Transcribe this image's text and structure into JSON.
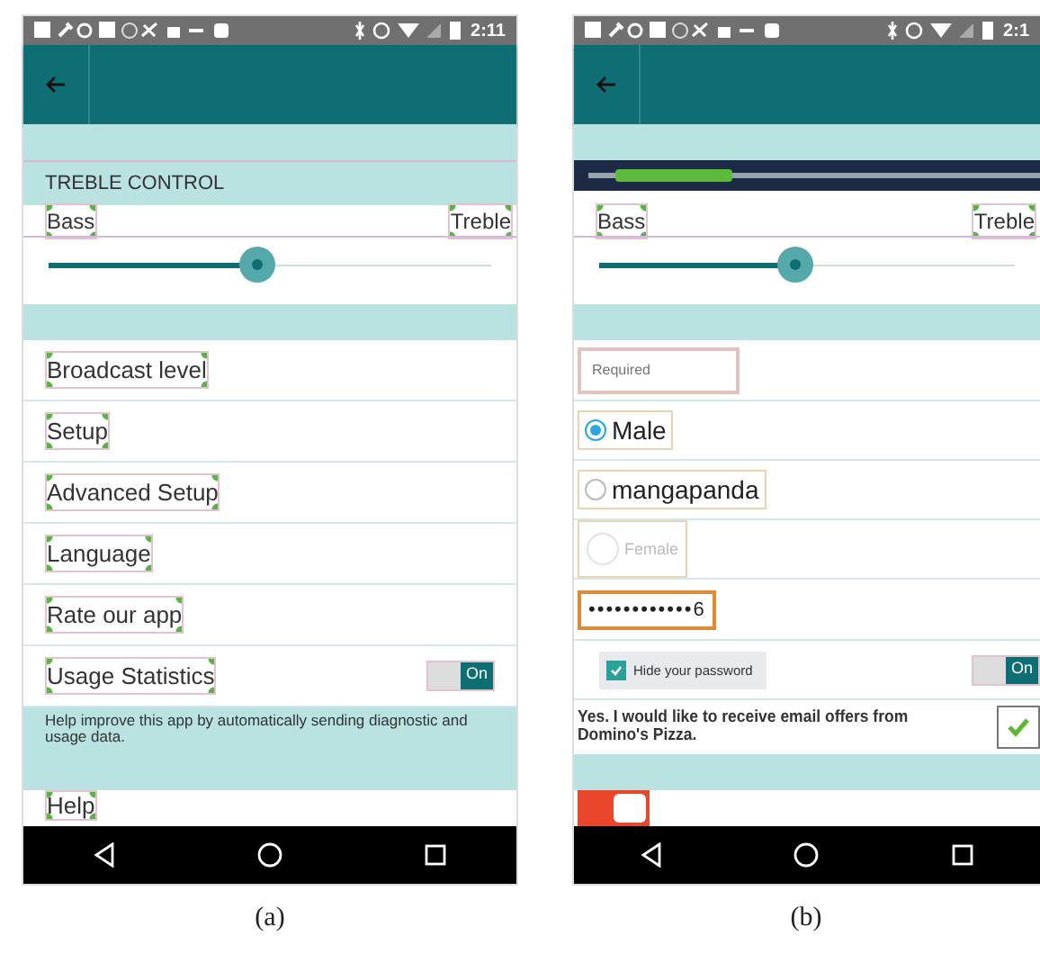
{
  "panels": [
    {
      "caption": "(a)",
      "status_time": "2:11",
      "items": [
        {
          "kind": "band"
        },
        {
          "kind": "header",
          "text": "TREBLE CONTROL"
        },
        {
          "kind": "ends",
          "left": "Bass",
          "right": "Treble"
        },
        {
          "kind": "slider",
          "level": 0.47
        },
        {
          "kind": "band"
        },
        {
          "kind": "row",
          "text": "Broadcast level"
        },
        {
          "kind": "row",
          "text": "Setup"
        },
        {
          "kind": "row",
          "text": "Advanced Setup"
        },
        {
          "kind": "row",
          "text": "Language"
        },
        {
          "kind": "row",
          "text": "Rate our app"
        },
        {
          "kind": "switch-row",
          "text": "Usage Statistics",
          "switch_label": "On",
          "on": true
        },
        {
          "kind": "help",
          "text": "Help improve this app by automatically sending diagnostic and usage data."
        },
        {
          "kind": "band"
        },
        {
          "kind": "row",
          "text": "Help"
        }
      ]
    },
    {
      "caption": "(b)",
      "status_time": "2:1",
      "items": [
        {
          "kind": "band"
        },
        {
          "kind": "progress"
        },
        {
          "kind": "ends",
          "left": "Bass",
          "right": "Treble"
        },
        {
          "kind": "slider",
          "level": 0.47
        },
        {
          "kind": "band"
        },
        {
          "kind": "field",
          "placeholder": "Required"
        },
        {
          "kind": "radio",
          "label": "Male",
          "selected": true,
          "disabled": false
        },
        {
          "kind": "radio",
          "label": "mangapanda",
          "selected": false,
          "disabled": false
        },
        {
          "kind": "radio",
          "label": "Female",
          "selected": false,
          "disabled": true
        },
        {
          "kind": "password",
          "value": "••••••••••••6"
        },
        {
          "kind": "checkbox-switch",
          "label": "Hide your password",
          "checked": true,
          "switch_label": "On",
          "on": true
        },
        {
          "kind": "consent",
          "text": "Yes. I would like to receive email offers from Domino's Pizza.",
          "checked": true
        },
        {
          "kind": "band"
        },
        {
          "kind": "toggle",
          "on": true
        }
      ]
    }
  ]
}
